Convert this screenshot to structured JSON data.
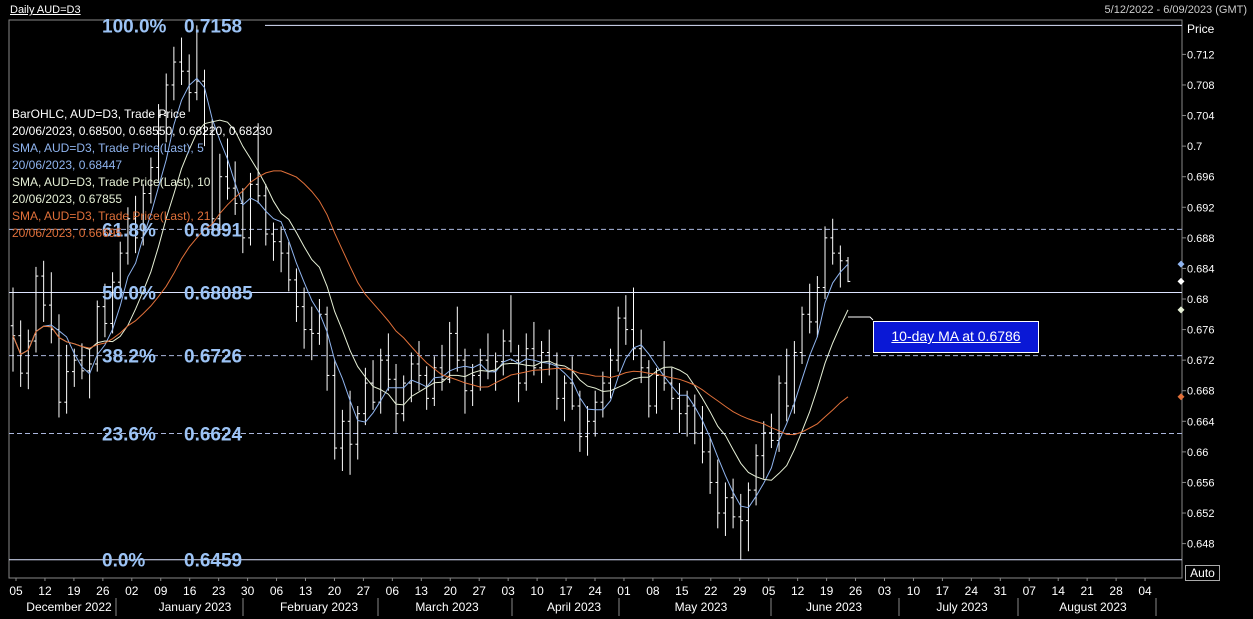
{
  "header": {
    "title": "Daily AUD=D3",
    "date_range": "5/12/2022 - 6/09/2023 (GMT)"
  },
  "chart_data": {
    "type": "bar",
    "subtype": "ohlc-bars-with-moving-averages-and-fibonacci",
    "y_axis_label": "Price",
    "ylim": [
      0.6435,
      0.7165
    ],
    "y_ticks": [
      "0.712",
      "0.708",
      "0.704",
      "0.7",
      "0.696",
      "0.692",
      "0.688",
      "0.684",
      "0.68",
      "0.676",
      "0.672",
      "0.668",
      "0.664",
      "0.66",
      "0.656",
      "0.652",
      "0.648"
    ],
    "x_day_ticks": [
      "05",
      "12",
      "19",
      "26",
      "02",
      "09",
      "16",
      "23",
      "30",
      "06",
      "13",
      "20",
      "27",
      "06",
      "13",
      "20",
      "27",
      "03",
      "10",
      "17",
      "24",
      "01",
      "08",
      "15",
      "22",
      "29",
      "05",
      "12",
      "19",
      "26",
      "03",
      "10",
      "17",
      "24",
      "31",
      "07",
      "14",
      "21",
      "28",
      "04"
    ],
    "x_month_labels": [
      "December 2022",
      "January 2023",
      "February 2023",
      "March 2023",
      "April 2023",
      "May 2023",
      "June 2023",
      "July 2023",
      "August 2023"
    ],
    "auto_button": "Auto",
    "fibonacci": [
      {
        "pct": "100.0%",
        "value": "0.7158",
        "level": 0.7158,
        "line": "solid"
      },
      {
        "pct": "61.8%",
        "value": "0.6891",
        "level": 0.6891,
        "line": "dashed"
      },
      {
        "pct": "50.0%",
        "value": "0.68085",
        "level": 0.68085,
        "line": "solid"
      },
      {
        "pct": "38.2%",
        "value": "0.6726",
        "level": 0.6726,
        "line": "dashed"
      },
      {
        "pct": "23.6%",
        "value": "0.6624",
        "level": 0.6624,
        "line": "dashed"
      },
      {
        "pct": "0.0%",
        "value": "0.6459",
        "level": 0.6459,
        "line": "solid"
      }
    ],
    "legend": [
      {
        "text": "BarOHLC, AUD=D3, Trade Price",
        "color": "#ffffff"
      },
      {
        "text": "20/06/2023, 0.68500, 0.68550, 0.68220, 0.68230",
        "color": "#ffffff"
      },
      {
        "text": "SMA, AUD=D3, Trade Price(Last),  5",
        "color": "#8fb4ef"
      },
      {
        "text": "20/06/2023, 0.68447",
        "color": "#8fb4ef"
      },
      {
        "text": "SMA, AUD=D3, Trade Price(Last),  10",
        "color": "#e6f0d6"
      },
      {
        "text": "20/06/2023, 0.67855",
        "color": "#e6f0d6"
      },
      {
        "text": "SMA, AUD=D3, Trade Price(Last),  21",
        "color": "#e0703a"
      },
      {
        "text": "20/06/2023, 0.66695",
        "color": "#e0703a"
      }
    ],
    "annotation": {
      "text": "10-day MA at 0.6786",
      "value": 0.6786
    },
    "colors": {
      "bars": "#ffffff",
      "sma5": "#8fb4ef",
      "sma10": "#e6f0d6",
      "sma21": "#e0703a",
      "fib_label": "#9cc3f5",
      "annotation_bg": "#0a18d6"
    },
    "ohlc": [
      [
        0.6765,
        0.6815,
        0.6705,
        0.6752
      ],
      [
        0.6752,
        0.6772,
        0.6685,
        0.6703
      ],
      [
        0.6703,
        0.676,
        0.6682,
        0.6745
      ],
      [
        0.6745,
        0.6842,
        0.673,
        0.683
      ],
      [
        0.683,
        0.685,
        0.677,
        0.6792
      ],
      [
        0.6792,
        0.6835,
        0.6742,
        0.676
      ],
      [
        0.676,
        0.678,
        0.6645,
        0.6665
      ],
      [
        0.6665,
        0.674,
        0.665,
        0.6705
      ],
      [
        0.6705,
        0.6735,
        0.6685,
        0.672
      ],
      [
        0.672,
        0.6742,
        0.6695,
        0.6706
      ],
      [
        0.6706,
        0.6735,
        0.667,
        0.6715
      ],
      [
        0.6715,
        0.6798,
        0.6705,
        0.679
      ],
      [
        0.679,
        0.682,
        0.675,
        0.6768
      ],
      [
        0.6768,
        0.6835,
        0.6755,
        0.6822
      ],
      [
        0.6822,
        0.6875,
        0.681,
        0.686
      ],
      [
        0.686,
        0.692,
        0.6845,
        0.6905
      ],
      [
        0.6905,
        0.6935,
        0.686,
        0.688
      ],
      [
        0.688,
        0.695,
        0.687,
        0.6938
      ],
      [
        0.6938,
        0.6985,
        0.6925,
        0.6972
      ],
      [
        0.6972,
        0.7055,
        0.6955,
        0.704
      ],
      [
        0.704,
        0.7095,
        0.7005,
        0.708
      ],
      [
        0.708,
        0.713,
        0.706,
        0.711
      ],
      [
        0.711,
        0.7142,
        0.708,
        0.7098
      ],
      [
        0.7098,
        0.712,
        0.7045,
        0.707
      ],
      [
        0.707,
        0.7158,
        0.706,
        0.7085
      ],
      [
        0.7085,
        0.71,
        0.7,
        0.702
      ],
      [
        0.702,
        0.7035,
        0.6885,
        0.6905
      ],
      [
        0.6905,
        0.699,
        0.6885,
        0.696
      ],
      [
        0.696,
        0.701,
        0.693,
        0.6945
      ],
      [
        0.6945,
        0.698,
        0.691,
        0.6925
      ],
      [
        0.6925,
        0.6945,
        0.686,
        0.688
      ],
      [
        0.688,
        0.6965,
        0.687,
        0.695
      ],
      [
        0.695,
        0.703,
        0.6925,
        0.6935
      ],
      [
        0.6935,
        0.695,
        0.687,
        0.6885
      ],
      [
        0.6885,
        0.69,
        0.685,
        0.6875
      ],
      [
        0.6875,
        0.6895,
        0.6835,
        0.686
      ],
      [
        0.686,
        0.6875,
        0.681,
        0.6825
      ],
      [
        0.6825,
        0.684,
        0.677,
        0.679
      ],
      [
        0.679,
        0.6815,
        0.6735,
        0.676
      ],
      [
        0.676,
        0.679,
        0.672,
        0.6755
      ],
      [
        0.6755,
        0.68,
        0.674,
        0.678
      ],
      [
        0.678,
        0.679,
        0.668,
        0.67
      ],
      [
        0.67,
        0.672,
        0.659,
        0.6605
      ],
      [
        0.6605,
        0.6655,
        0.6575,
        0.664
      ],
      [
        0.664,
        0.668,
        0.657,
        0.661
      ],
      [
        0.661,
        0.666,
        0.659,
        0.665
      ],
      [
        0.665,
        0.671,
        0.6635,
        0.669
      ],
      [
        0.669,
        0.672,
        0.6655,
        0.6665
      ],
      [
        0.6665,
        0.6735,
        0.665,
        0.672
      ],
      [
        0.672,
        0.6755,
        0.668,
        0.6695
      ],
      [
        0.6695,
        0.6715,
        0.6625,
        0.665
      ],
      [
        0.665,
        0.67,
        0.664,
        0.669
      ],
      [
        0.669,
        0.673,
        0.6665,
        0.6715
      ],
      [
        0.6715,
        0.6745,
        0.668,
        0.67
      ],
      [
        0.67,
        0.6712,
        0.6655,
        0.667
      ],
      [
        0.667,
        0.6725,
        0.666,
        0.671
      ],
      [
        0.671,
        0.674,
        0.668,
        0.6695
      ],
      [
        0.6695,
        0.677,
        0.669,
        0.6755
      ],
      [
        0.6755,
        0.679,
        0.6705,
        0.672
      ],
      [
        0.672,
        0.6735,
        0.665,
        0.668
      ],
      [
        0.668,
        0.6715,
        0.666,
        0.67
      ],
      [
        0.67,
        0.6735,
        0.668,
        0.672
      ],
      [
        0.672,
        0.6755,
        0.6695,
        0.6705
      ],
      [
        0.6705,
        0.673,
        0.668,
        0.6718
      ],
      [
        0.6718,
        0.676,
        0.67,
        0.6745
      ],
      [
        0.6745,
        0.6805,
        0.673,
        0.672
      ],
      [
        0.672,
        0.674,
        0.6665,
        0.669
      ],
      [
        0.669,
        0.6755,
        0.668,
        0.6735
      ],
      [
        0.6735,
        0.677,
        0.67,
        0.671
      ],
      [
        0.671,
        0.6745,
        0.669,
        0.673
      ],
      [
        0.673,
        0.676,
        0.67,
        0.6715
      ],
      [
        0.6715,
        0.673,
        0.6655,
        0.667
      ],
      [
        0.667,
        0.67,
        0.664,
        0.669
      ],
      [
        0.669,
        0.6725,
        0.6655,
        0.666
      ],
      [
        0.666,
        0.668,
        0.66,
        0.662
      ],
      [
        0.662,
        0.666,
        0.6595,
        0.664
      ],
      [
        0.664,
        0.668,
        0.662,
        0.6665
      ],
      [
        0.6665,
        0.6705,
        0.6645,
        0.669
      ],
      [
        0.669,
        0.6735,
        0.667,
        0.672
      ],
      [
        0.672,
        0.679,
        0.6705,
        0.6775
      ],
      [
        0.6775,
        0.6805,
        0.674,
        0.676
      ],
      [
        0.676,
        0.6815,
        0.672,
        0.6735
      ],
      [
        0.6735,
        0.676,
        0.669,
        0.671
      ],
      [
        0.671,
        0.672,
        0.6645,
        0.666
      ],
      [
        0.666,
        0.671,
        0.665,
        0.67
      ],
      [
        0.67,
        0.6745,
        0.668,
        0.669
      ],
      [
        0.669,
        0.671,
        0.6655,
        0.667
      ],
      [
        0.667,
        0.669,
        0.6625,
        0.665
      ],
      [
        0.665,
        0.668,
        0.662,
        0.666
      ],
      [
        0.666,
        0.6675,
        0.661,
        0.6625
      ],
      [
        0.6625,
        0.666,
        0.6585,
        0.66
      ],
      [
        0.66,
        0.662,
        0.6545,
        0.656
      ],
      [
        0.656,
        0.659,
        0.65,
        0.652
      ],
      [
        0.652,
        0.656,
        0.649,
        0.654
      ],
      [
        0.654,
        0.6565,
        0.65,
        0.6515
      ],
      [
        0.6515,
        0.6545,
        0.6459,
        0.651
      ],
      [
        0.651,
        0.656,
        0.647,
        0.655
      ],
      [
        0.655,
        0.661,
        0.653,
        0.6595
      ],
      [
        0.6595,
        0.664,
        0.6565,
        0.6625
      ],
      [
        0.6625,
        0.665,
        0.6605,
        0.6615
      ],
      [
        0.6615,
        0.67,
        0.66,
        0.669
      ],
      [
        0.669,
        0.6735,
        0.664,
        0.666
      ],
      [
        0.666,
        0.6745,
        0.665,
        0.673
      ],
      [
        0.673,
        0.679,
        0.6715,
        0.678
      ],
      [
        0.678,
        0.682,
        0.6755,
        0.677
      ],
      [
        0.677,
        0.683,
        0.675,
        0.6815
      ],
      [
        0.6815,
        0.6895,
        0.68,
        0.688
      ],
      [
        0.688,
        0.6905,
        0.6845,
        0.686
      ],
      [
        0.686,
        0.687,
        0.6815,
        0.685
      ],
      [
        0.685,
        0.6855,
        0.6822,
        0.6823
      ]
    ]
  }
}
